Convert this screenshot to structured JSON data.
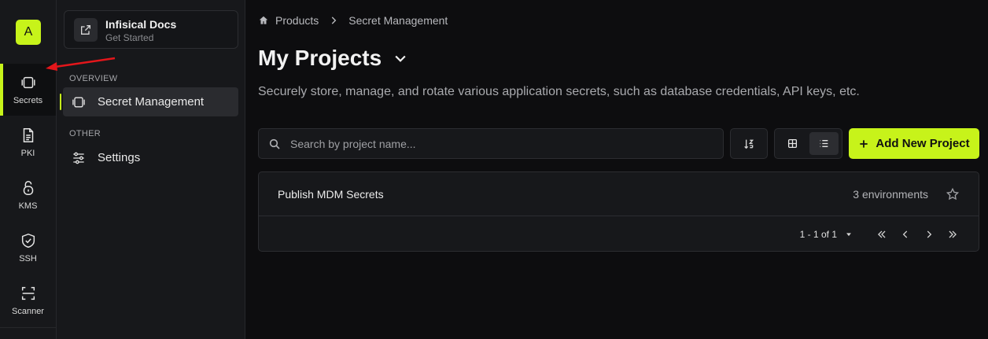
{
  "colors": {
    "accent": "#c7f31a",
    "arrow": "#e3161b"
  },
  "rail": {
    "org_avatar": "A",
    "items": [
      {
        "label": "Secrets",
        "icon": "vault-icon"
      },
      {
        "label": "PKI",
        "icon": "document-icon"
      },
      {
        "label": "KMS",
        "icon": "lock-icon"
      },
      {
        "label": "SSH",
        "icon": "shield-icon"
      },
      {
        "label": "Scanner",
        "icon": "scan-icon"
      }
    ]
  },
  "sidebar": {
    "docs_title": "Infisical Docs",
    "docs_subtitle": "Get Started",
    "overview_label": "OVERVIEW",
    "secret_management_label": "Secret Management",
    "other_label": "OTHER",
    "settings_label": "Settings"
  },
  "breadcrumb": {
    "products": "Products",
    "current": "Secret Management"
  },
  "page": {
    "title": "My Projects",
    "description": "Securely store, manage, and rotate various application secrets, such as database credentials, API keys, etc."
  },
  "toolbar": {
    "search_placeholder": "Search by project name...",
    "add_button": "Add New Project"
  },
  "projects": [
    {
      "name": "Publish MDM Secrets",
      "environments": "3 environments"
    }
  ],
  "pagination": {
    "range": "1 - 1 of 1"
  }
}
